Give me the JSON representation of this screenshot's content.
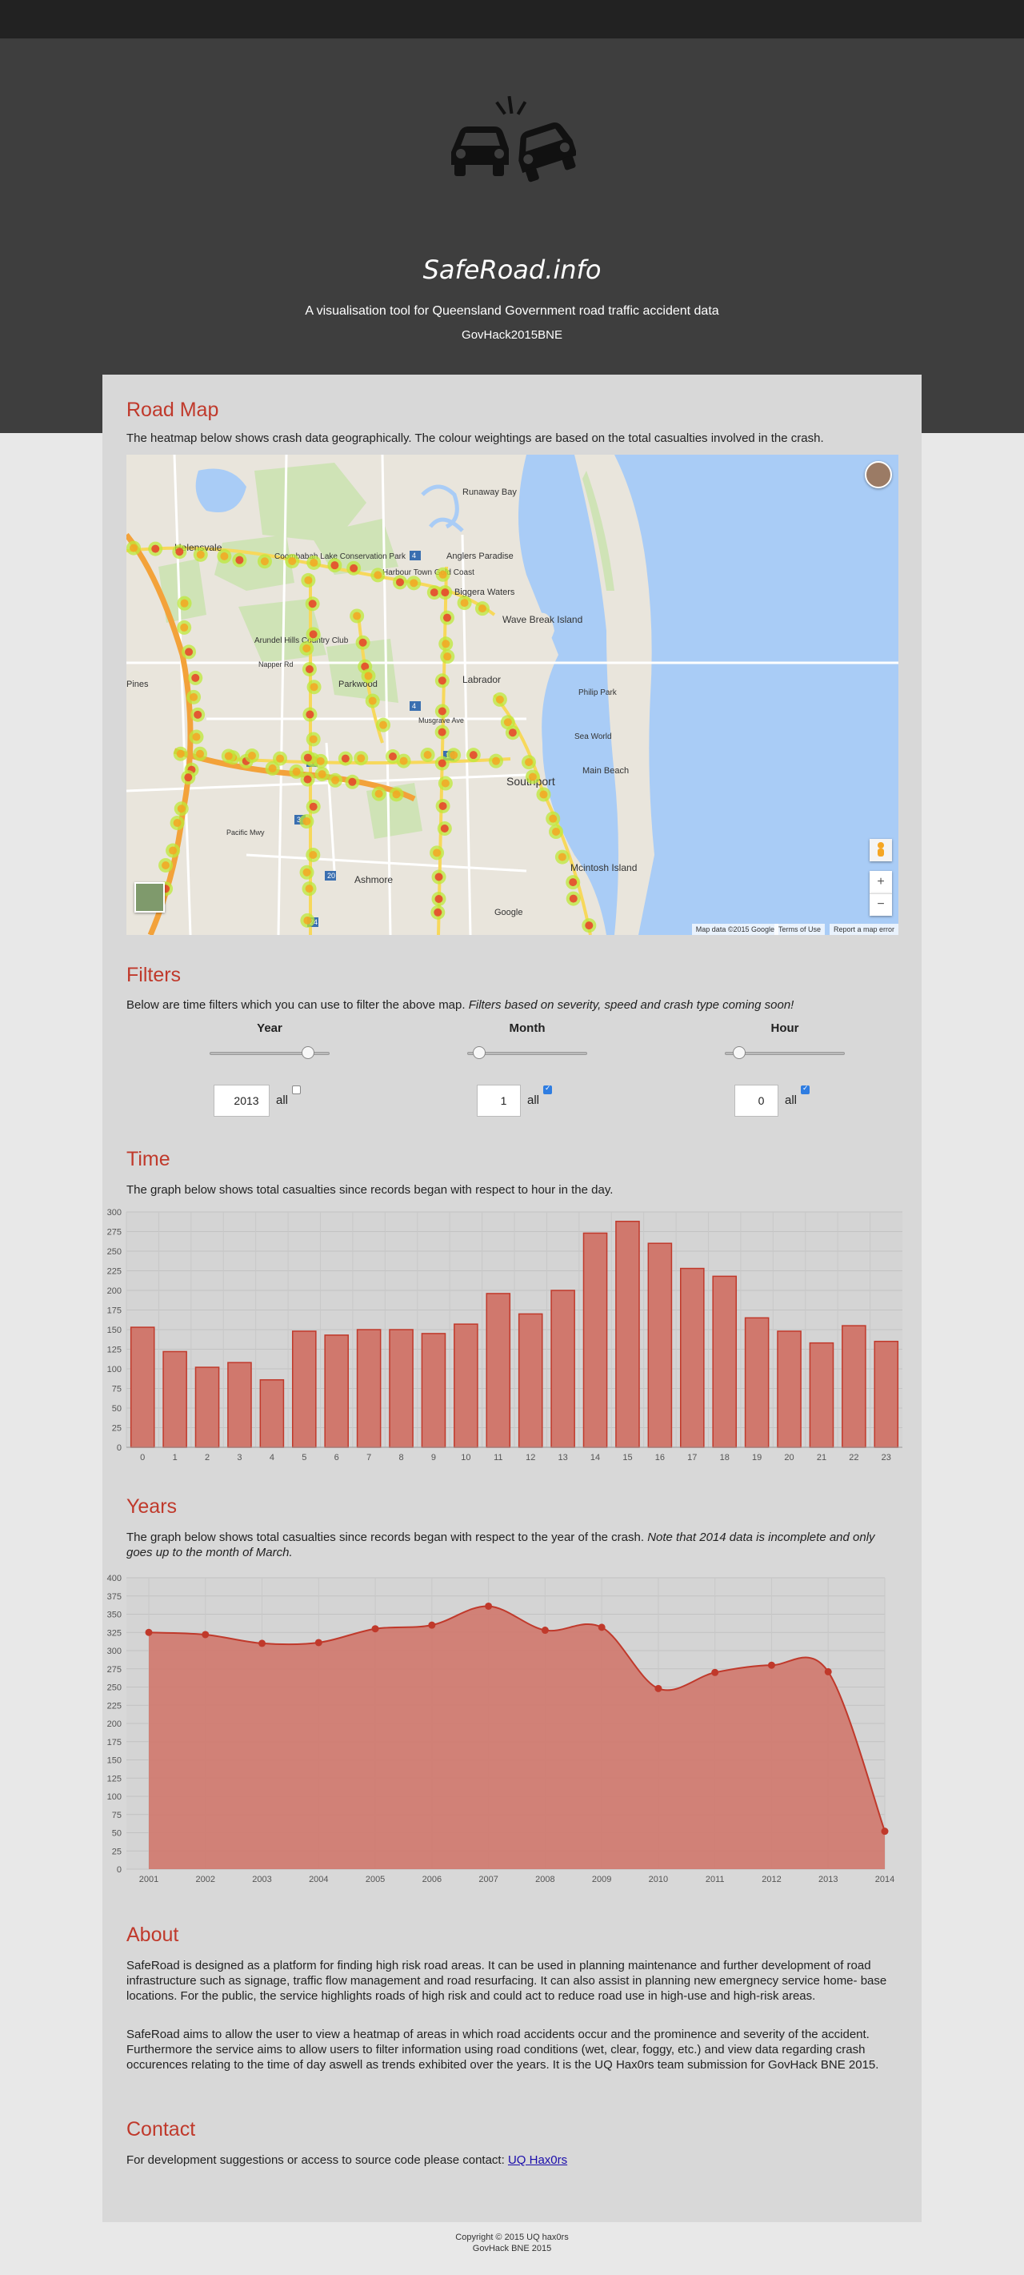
{
  "header": {
    "logo_icon": "car-crash-icon",
    "title": "SafeRoad.info",
    "tagline": "A visualisation tool for Queensland Government road traffic accident data",
    "event": "GovHack2015BNE"
  },
  "road_map": {
    "heading": "Road Map",
    "description": "The heatmap below shows crash data geographically. The colour weightings are based on the total casualties involved in the crash.",
    "place_labels": [
      "Runaway Bay",
      "Helensvale",
      "Coombabah Lake Conservation Park",
      "Harbour Town Gold Coast",
      "Anglers Paradise",
      "Biggera Waters",
      "Wave Break Island",
      "Arundel Hills Country Club",
      "Napper Rd",
      "Parkwood",
      "Labrador",
      "Pines",
      "Musgrave Ave",
      "Philip Park",
      "Sea World",
      "Main Beach",
      "Southport",
      "Ashmore",
      "Mcintosh Island",
      "Google",
      "Pacific Mwy"
    ],
    "zoom_in": "+",
    "zoom_out": "−",
    "pegman_icon": "street-view-icon",
    "attribution": [
      "Map data ©2015 Google",
      "Terms of Use",
      "Report a map error"
    ],
    "colors": {
      "water": "#a9ccf6",
      "land": "#e9e5dc",
      "park": "#cfe3b6",
      "highway": "#f3a23a",
      "heat_hot": "#e8402a",
      "heat_warm": "#f5a623",
      "heat_cool": "#bde83a"
    }
  },
  "filters": {
    "heading": "Filters",
    "description": "Below are time filters which you can use to filter the above map.",
    "description_note": "Filters based on severity, speed and crash type coming soon!",
    "controls": [
      {
        "label": "Year",
        "value": "2013",
        "all_label": "all",
        "all_checked": false,
        "slider_fraction": 0.82
      },
      {
        "label": "Month",
        "value": "1",
        "all_label": "all",
        "all_checked": true,
        "slider_fraction": 0.1
      },
      {
        "label": "Hour",
        "value": "0",
        "all_label": "all",
        "all_checked": true,
        "slider_fraction": 0.12
      }
    ]
  },
  "time_section": {
    "heading": "Time",
    "description": "The graph below shows total casualties since records began with respect to hour in the day."
  },
  "years_section": {
    "heading": "Years",
    "description": "The graph below shows total casualties since records began with respect to the year of the crash.",
    "description_note": "Note that 2014 data is incomplete and only goes up to the month of March."
  },
  "chart_data": [
    {
      "type": "bar",
      "title": "",
      "xlabel": "",
      "ylabel": "",
      "categories": [
        "0",
        "1",
        "2",
        "3",
        "4",
        "5",
        "6",
        "7",
        "8",
        "9",
        "10",
        "11",
        "12",
        "13",
        "14",
        "15",
        "16",
        "17",
        "18",
        "19",
        "20",
        "21",
        "22",
        "23"
      ],
      "values": [
        153,
        122,
        102,
        108,
        86,
        148,
        143,
        150,
        150,
        145,
        157,
        196,
        170,
        200,
        273,
        288,
        260,
        228,
        218,
        165,
        148,
        133,
        155,
        135
      ],
      "ylim": [
        0,
        300
      ],
      "yticks": [
        0,
        25,
        50,
        75,
        100,
        125,
        150,
        175,
        200,
        225,
        250,
        275,
        300
      ],
      "grid": true,
      "color": "#d0786d"
    },
    {
      "type": "area",
      "title": "",
      "xlabel": "",
      "ylabel": "",
      "x": [
        "2001",
        "2002",
        "2003",
        "2004",
        "2005",
        "2006",
        "2007",
        "2008",
        "2009",
        "2010",
        "2011",
        "2012",
        "2013",
        "2014"
      ],
      "values": [
        325,
        322,
        310,
        311,
        330,
        335,
        361,
        328,
        332,
        248,
        270,
        280,
        271,
        52
      ],
      "ylim": [
        0,
        400
      ],
      "yticks": [
        0,
        25,
        50,
        75,
        100,
        125,
        150,
        175,
        200,
        225,
        250,
        275,
        300,
        325,
        350,
        375,
        400
      ],
      "grid": true,
      "color": "#d0786d"
    }
  ],
  "about": {
    "heading": "About",
    "para1": "SafeRoad is designed as a platform for finding high risk road areas. It can be used in planning maintenance and further development of road infrastructure such as signage, traffic flow management and road resurfacing. It can also assist in planning new emergnecy service home- base locations. For the public, the service highlights roads of high risk and could act to reduce road use in high-use and high-risk areas.",
    "para2": "SafeRoad aims to allow the user to view a heatmap of areas in which road accidents occur and the prominence and severity of the accident. Furthermore the service aims to allow users to filter information using road conditions (wet, clear, foggy, etc.) and view data regarding crash occurences relating to the time of day aswell as trends exhibited over the years. It is the UQ Hax0rs team submission for GovHack BNE 2015."
  },
  "contact": {
    "heading": "Contact",
    "text": "For development suggestions or access to source code please contact:",
    "link_text": "UQ Hax0rs"
  },
  "footer": {
    "copyright": "Copyright © 2015 UQ hax0rs",
    "event": "GovHack BNE 2015"
  }
}
